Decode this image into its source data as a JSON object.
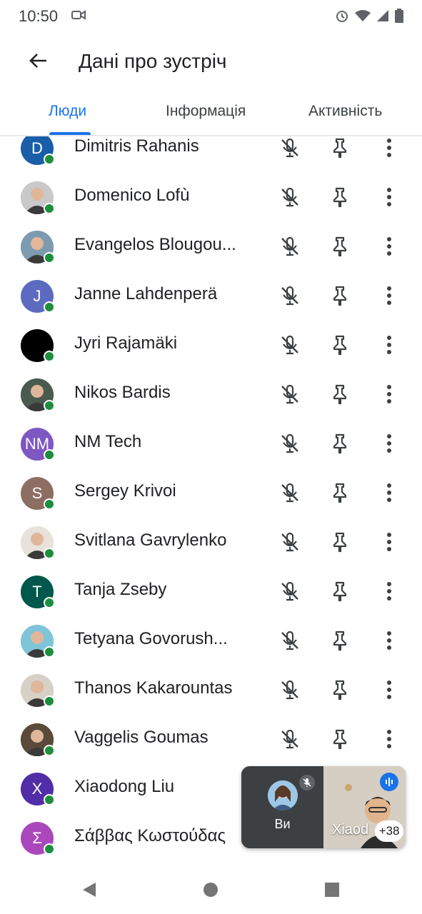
{
  "status": {
    "time": "10:50",
    "icons": [
      "video-camera-icon",
      "alarm-icon",
      "wifi-icon",
      "signal-icon",
      "battery-icon"
    ]
  },
  "header": {
    "title": "Дані про зустріч",
    "back_icon": "arrow-back-icon"
  },
  "tabs": [
    {
      "label": "Люди",
      "active": true
    },
    {
      "label": "Інформація",
      "active": false
    },
    {
      "label": "Активність",
      "active": false
    }
  ],
  "participants": [
    {
      "name": "Dimitris Rahanis",
      "initials": "D",
      "avatar_color": "#1a5ea8",
      "photo": false
    },
    {
      "name": "Domenico Lofù",
      "initials": "",
      "avatar_color": "#c9c9c9",
      "photo": true
    },
    {
      "name": "Evangelos Blougou...",
      "initials": "",
      "avatar_color": "#7d9bb0",
      "photo": true
    },
    {
      "name": "Janne Lahdenperä",
      "initials": "J",
      "avatar_color": "#5c6bc0",
      "photo": false
    },
    {
      "name": "Jyri Rajamäki",
      "initials": "",
      "avatar_color": "#000000",
      "photo": false
    },
    {
      "name": "Nikos Bardis",
      "initials": "",
      "avatar_color": "#4a5a4e",
      "photo": true
    },
    {
      "name": "NM Tech",
      "initials": "NM",
      "avatar_color": "#7e57c2",
      "photo": false
    },
    {
      "name": "Sergey Krivoi",
      "initials": "S",
      "avatar_color": "#8d6e63",
      "photo": false
    },
    {
      "name": "Svitlana Gavrylenko",
      "initials": "",
      "avatar_color": "#e8e2da",
      "photo": true
    },
    {
      "name": "Tanja Zseby",
      "initials": "T",
      "avatar_color": "#00574b",
      "photo": false
    },
    {
      "name": "Tetyana Govorush...",
      "initials": "",
      "avatar_color": "#7fc4d8",
      "photo": true
    },
    {
      "name": "Thanos Kakarountas",
      "initials": "",
      "avatar_color": "#d7d0c6",
      "photo": true
    },
    {
      "name": "Vaggelis Goumas",
      "initials": "",
      "avatar_color": "#5a4a3a",
      "photo": true
    },
    {
      "name": "Xiaodong Liu",
      "initials": "X",
      "avatar_color": "#512da8",
      "photo": false
    },
    {
      "name": "Σάββας Κωστούδας",
      "initials": "Σ",
      "avatar_color": "#ab47bc",
      "photo": false
    }
  ],
  "row_icons": {
    "mic": "mic-off-icon",
    "pin": "pin-icon",
    "more": "more-vert-icon"
  },
  "pip": {
    "you_label": "Ви",
    "remote_name": "Xiaod",
    "more_count": "+38"
  },
  "nav": [
    "back-triangle-icon",
    "home-circle-icon",
    "recents-square-icon"
  ]
}
